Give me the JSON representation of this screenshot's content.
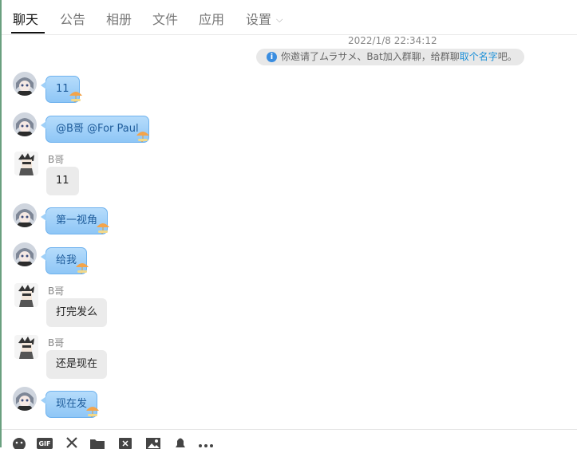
{
  "tabs": [
    {
      "label": "聊天",
      "active": true
    },
    {
      "label": "公告"
    },
    {
      "label": "相册"
    },
    {
      "label": "文件"
    },
    {
      "label": "应用"
    },
    {
      "label": "设置"
    }
  ],
  "chat": {
    "timestamp": "2022/1/8 22:34:12",
    "system_notice": {
      "text": "你邀请了ムラサメ、Bat加入群聊，给群聊",
      "link": "取个名字",
      "suffix": "吧。"
    },
    "messages": [
      {
        "sender": "",
        "text": "11",
        "style": "blue"
      },
      {
        "sender": "",
        "text": "@B哥 @For Paul",
        "style": "blue"
      },
      {
        "sender": "B哥",
        "text": "11",
        "style": "gray"
      },
      {
        "sender": "",
        "text": "第一视角",
        "style": "blue"
      },
      {
        "sender": "",
        "text": "给我",
        "style": "blue"
      },
      {
        "sender": "B哥",
        "text": "打完发么",
        "style": "gray"
      },
      {
        "sender": "B哥",
        "text": "还是现在",
        "style": "gray"
      },
      {
        "sender": "",
        "text": "现在发",
        "style": "blue"
      }
    ]
  },
  "toolbar": {
    "icons": [
      "emoji-icon",
      "gif-icon",
      "scissors-icon",
      "folder-icon",
      "red-packet-icon",
      "image-icon",
      "bell-icon",
      "more-icon"
    ]
  },
  "colors": {
    "bubble_blue": "#a8d5fa",
    "bubble_gray": "#ebebeb",
    "link": "#1a8fd8",
    "accent_edge": "#6aa07f"
  }
}
